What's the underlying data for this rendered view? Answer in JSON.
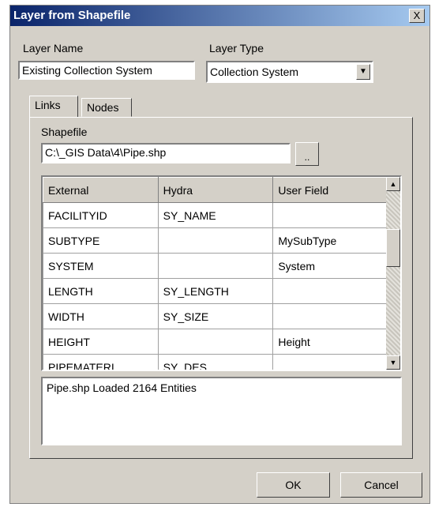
{
  "title": "Layer from Shapefile",
  "close_label": "X",
  "layer_name": {
    "label": "Layer Name",
    "value": "Existing Collection System"
  },
  "layer_type": {
    "label": "Layer Type",
    "value": "Collection System"
  },
  "tabs": {
    "links": "Links",
    "nodes": "Nodes"
  },
  "shapefile": {
    "label": "Shapefile",
    "path": "C:\\_GIS Data\\4\\Pipe.shp",
    "browse_label": ".."
  },
  "grid": {
    "headers": [
      "External",
      "Hydra",
      "User Field"
    ],
    "rows": [
      [
        "FACILITYID",
        "SY_NAME",
        ""
      ],
      [
        "SUBTYPE",
        "",
        "MySubType"
      ],
      [
        "SYSTEM",
        "",
        "System"
      ],
      [
        "LENGTH",
        "SY_LENGTH",
        ""
      ],
      [
        "WIDTH",
        "SY_SIZE",
        ""
      ],
      [
        "HEIGHT",
        "",
        "Height"
      ],
      [
        "PIPEMATERI",
        "SY_DES",
        ""
      ]
    ]
  },
  "log_text": "Pipe.shp Loaded 2164 Entities",
  "buttons": {
    "ok": "OK",
    "cancel": "Cancel"
  }
}
